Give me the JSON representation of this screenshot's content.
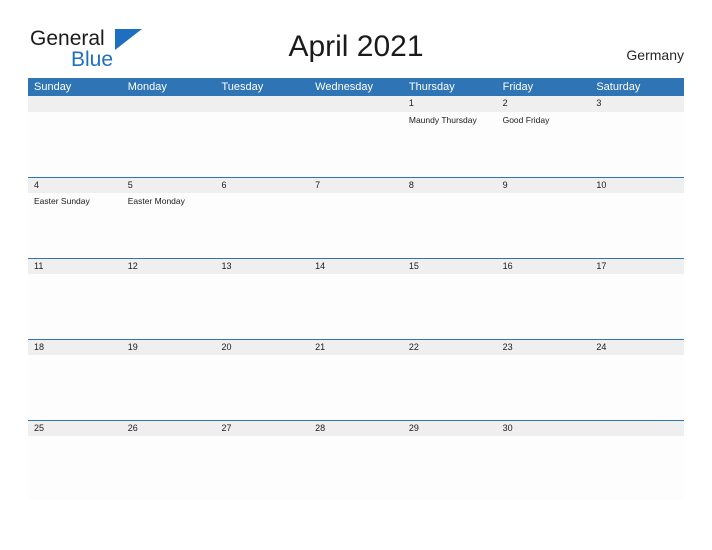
{
  "brand": {
    "name_part1": "General",
    "name_part2": "Blue",
    "triangle_icon": "triangle-icon",
    "accent_color": "#1f6fc0"
  },
  "header": {
    "title": "April 2021",
    "country": "Germany"
  },
  "theme": {
    "header_blue": "#2f74b5",
    "date_band_gray": "#efefef",
    "text_dark": "#1b1b1b"
  },
  "calendar": {
    "weekdays": [
      "Sunday",
      "Monday",
      "Tuesday",
      "Wednesday",
      "Thursday",
      "Friday",
      "Saturday"
    ],
    "weeks": [
      {
        "dates": [
          "",
          "",
          "",
          "",
          "1",
          "2",
          "3"
        ],
        "events": [
          "",
          "",
          "",
          "",
          "Maundy Thursday",
          "Good Friday",
          ""
        ]
      },
      {
        "dates": [
          "4",
          "5",
          "6",
          "7",
          "8",
          "9",
          "10"
        ],
        "events": [
          "Easter Sunday",
          "Easter Monday",
          "",
          "",
          "",
          "",
          ""
        ]
      },
      {
        "dates": [
          "11",
          "12",
          "13",
          "14",
          "15",
          "16",
          "17"
        ],
        "events": [
          "",
          "",
          "",
          "",
          "",
          "",
          ""
        ]
      },
      {
        "dates": [
          "18",
          "19",
          "20",
          "21",
          "22",
          "23",
          "24"
        ],
        "events": [
          "",
          "",
          "",
          "",
          "",
          "",
          ""
        ]
      },
      {
        "dates": [
          "25",
          "26",
          "27",
          "28",
          "29",
          "30",
          ""
        ],
        "events": [
          "",
          "",
          "",
          "",
          "",
          "",
          ""
        ]
      }
    ]
  }
}
